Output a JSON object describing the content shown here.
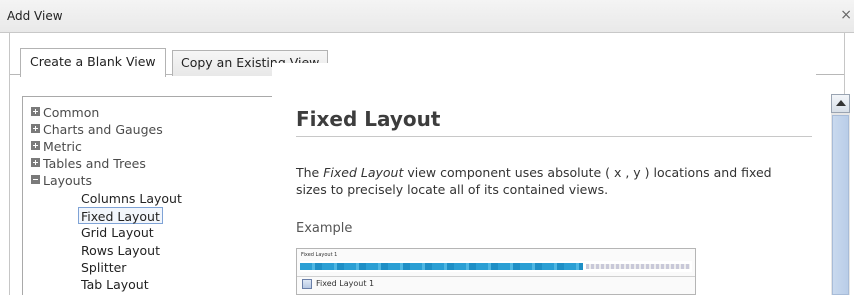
{
  "window": {
    "title": "Add View",
    "close_glyph": "×"
  },
  "tabs": [
    {
      "label": "Create a Blank View",
      "active": true
    },
    {
      "label": "Copy an Existing View",
      "active": false
    }
  ],
  "tree": {
    "categories": [
      {
        "label": "Common",
        "expanded": false
      },
      {
        "label": "Charts and Gauges",
        "expanded": false
      },
      {
        "label": "Metric",
        "expanded": false
      },
      {
        "label": "Tables and Trees",
        "expanded": false
      },
      {
        "label": "Layouts",
        "expanded": true
      }
    ],
    "layout_children": [
      {
        "label": "Columns Layout",
        "selected": false
      },
      {
        "label": "Fixed Layout",
        "selected": true
      },
      {
        "label": "Grid Layout",
        "selected": false
      },
      {
        "label": "Rows Layout",
        "selected": false
      },
      {
        "label": "Splitter",
        "selected": false
      },
      {
        "label": "Tab Layout",
        "selected": false
      }
    ]
  },
  "detail": {
    "heading": "Fixed Layout",
    "desc_prefix": "The ",
    "desc_em": "Fixed Layout",
    "desc_suffix": " view component uses absolute ( x , y ) locations and fixed sizes to precisely locate all of its contained views.",
    "example_label": "Example",
    "example_title": "Fixed Layout 1",
    "example_item": "Fixed Layout 1"
  },
  "icons": {
    "close": "close-icon",
    "expand": "expand-plus-icon",
    "collapse": "collapse-minus-icon",
    "scroll_up": "scroll-up-arrow-icon"
  },
  "colors": {
    "selection_border": "#7fa3d6",
    "scroll_thumb": "#c9d9ee",
    "example_bar": "#2b9fd4"
  }
}
